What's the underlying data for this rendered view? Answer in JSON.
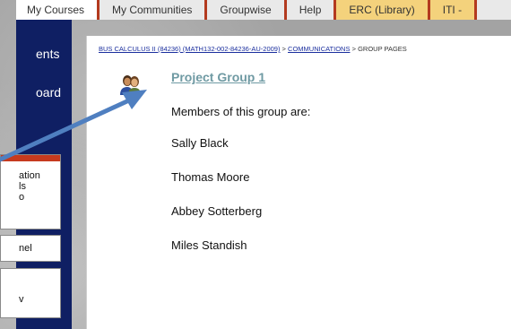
{
  "tabs": [
    {
      "label": "My Courses",
      "active": true
    },
    {
      "label": "My Communities"
    },
    {
      "label": "Groupwise"
    },
    {
      "label": "Help"
    },
    {
      "label": "ERC (Library)"
    },
    {
      "label": "ITI -"
    }
  ],
  "sidebar": {
    "item_1": "ents",
    "item_2": "oard",
    "box_1": {
      "lines": [
        "ation",
        "ls",
        "o"
      ]
    },
    "box_2": {
      "lines": [
        "nel"
      ]
    },
    "box_3": {
      "lines": [
        "v"
      ]
    }
  },
  "breadcrumb": {
    "course_link": "BUS CALCULUS II (84236) (MATH132-002-84236-AU-2009)",
    "sep_1": ">",
    "section_link": "COMMUNICATIONS",
    "sep_2": ">",
    "current": "GROUP PAGES"
  },
  "group": {
    "icon": "group-people-icon",
    "title": "Project Group 1",
    "members_intro": "Members of this group are:",
    "members": [
      "Sally Black",
      "Thomas Moore",
      "Abbey Sotterberg",
      "Miles Standish"
    ]
  },
  "colors": {
    "sidebar": "#0f1f63",
    "tab_divider": "#b33a1f",
    "title_link": "#6f9aa3",
    "breadcrumb_link": "#1b2f9e",
    "arrow": "#4f7fc0"
  }
}
